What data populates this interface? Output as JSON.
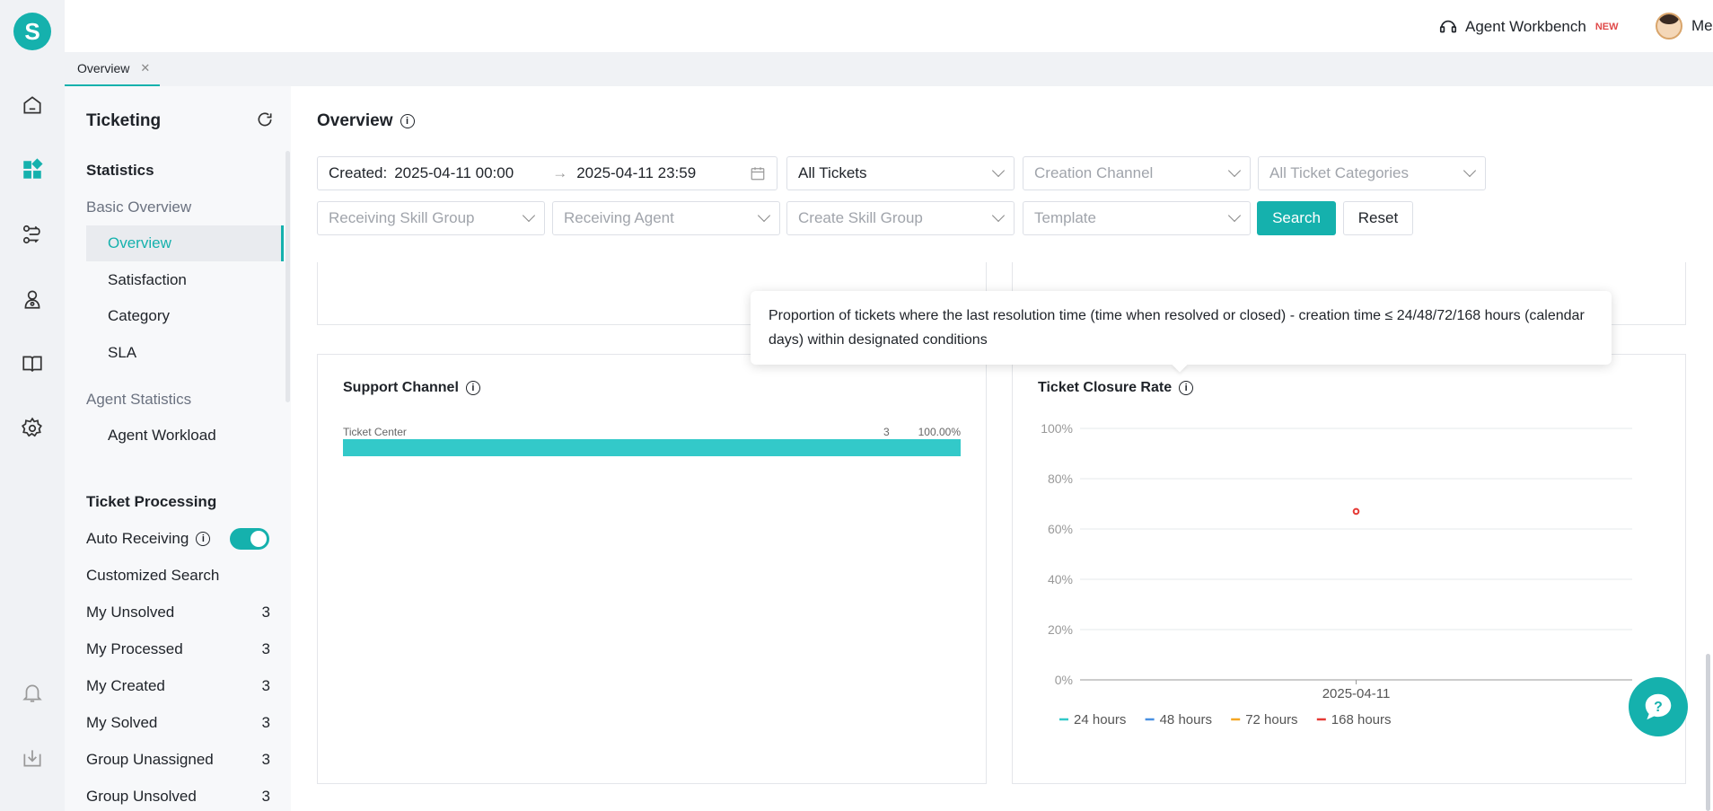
{
  "header": {
    "workbench_label": "Agent Workbench",
    "workbench_badge": "NEW",
    "user_name": "Merry"
  },
  "tabs": [
    {
      "label": "Overview",
      "close": "✕"
    }
  ],
  "sidebar": {
    "title": "Ticketing",
    "statistics_heading": "Statistics",
    "basic_overview_group": "Basic Overview",
    "basic_items": [
      "Overview",
      "Satisfaction",
      "Category",
      "SLA"
    ],
    "agent_statistics_group": "Agent Statistics",
    "agent_items": [
      "Agent Workload"
    ],
    "ticket_processing_heading": "Ticket Processing",
    "auto_receiving_label": "Auto Receiving",
    "auto_receiving_on": true,
    "customized_search_label": "Customized Search",
    "views": [
      {
        "label": "My Unsolved",
        "count": "3"
      },
      {
        "label": "My Processed",
        "count": "3"
      },
      {
        "label": "My Created",
        "count": "3"
      },
      {
        "label": "My Solved",
        "count": "3"
      },
      {
        "label": "Group Unassigned",
        "count": "3"
      },
      {
        "label": "Group Unsolved",
        "count": "3"
      }
    ]
  },
  "main": {
    "title": "Overview",
    "filters": {
      "created_label": "Created:",
      "date_start": "2025-04-11 00:00",
      "date_arrow": "→",
      "date_end": "2025-04-11 23:59",
      "ticket_scope": "All Tickets",
      "creation_channel_placeholder": "Creation Channel",
      "ticket_categories_placeholder": "All Ticket Categories",
      "receiving_skill_group_placeholder": "Receiving Skill Group",
      "receiving_agent_placeholder": "Receiving Agent",
      "create_skill_group_placeholder": "Create Skill Group",
      "template_placeholder": "Template",
      "search_label": "Search",
      "reset_label": "Reset"
    },
    "tooltip_text": "Proportion of tickets where the last resolution time (time when resolved or closed) - creation time ≤ 24/48/72/168 hours (calendar days) within designated conditions",
    "support_channel": {
      "title": "Support Channel",
      "rows": [
        {
          "label": "Ticket Center",
          "count": "3",
          "percent": "100.00%",
          "fraction": 1.0
        }
      ]
    },
    "closure_rate": {
      "title": "Ticket Closure Rate"
    }
  },
  "colors": {
    "accent": "#15b1ad",
    "bar": "#33c9c9"
  },
  "chart_data": {
    "type": "line",
    "title": "Ticket Closure Rate",
    "x": [
      "2025-04-11"
    ],
    "y_ticks": [
      "100%",
      "80%",
      "60%",
      "40%",
      "20%",
      "0%"
    ],
    "ylim": [
      0,
      100
    ],
    "series": [
      {
        "name": "24 hours",
        "color": "#33c9c9",
        "values": [
          null
        ]
      },
      {
        "name": "48 hours",
        "color": "#4a90e2",
        "values": [
          null
        ]
      },
      {
        "name": "72 hours",
        "color": "#f5a623",
        "values": [
          null
        ]
      },
      {
        "name": "168 hours",
        "color": "#e53935",
        "values": [
          67
        ]
      }
    ],
    "legend": "bottom-left",
    "grid": true
  }
}
